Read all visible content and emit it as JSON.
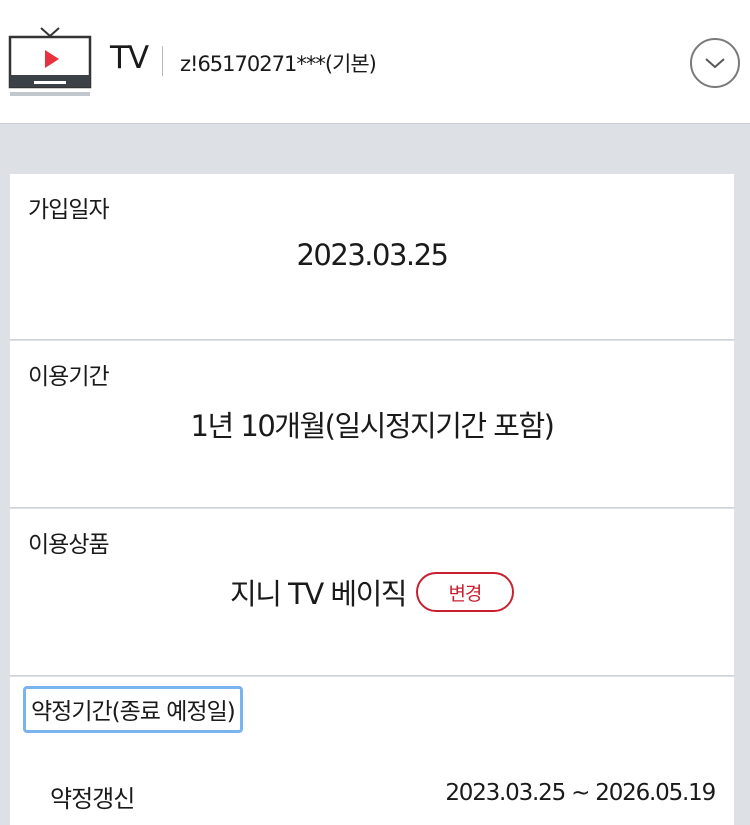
{
  "header": {
    "service_name": "TV",
    "account": "z!65170271***(기본)",
    "icons": {
      "service": "tv-icon",
      "toggle": "chevron-down-icon"
    }
  },
  "subscription_date": {
    "label": "가입일자",
    "value": "2023.03.25"
  },
  "usage_period": {
    "label": "이용기간",
    "value": "1년 10개월(일시정지기간 포함)"
  },
  "product": {
    "label": "이용상품",
    "value": "지니 TV 베이직",
    "change_label": "변경"
  },
  "contract": {
    "label": "약정기간(종료 예정일)",
    "renewal_label": "약정갱신",
    "renewal_period": "2023.03.25 ~ 2026.05.19"
  },
  "colors": {
    "accent_red": "#c8202e",
    "focus_blue": "#7ab4f0",
    "background": "#dde1e6",
    "teal": "#1d9a8a"
  }
}
